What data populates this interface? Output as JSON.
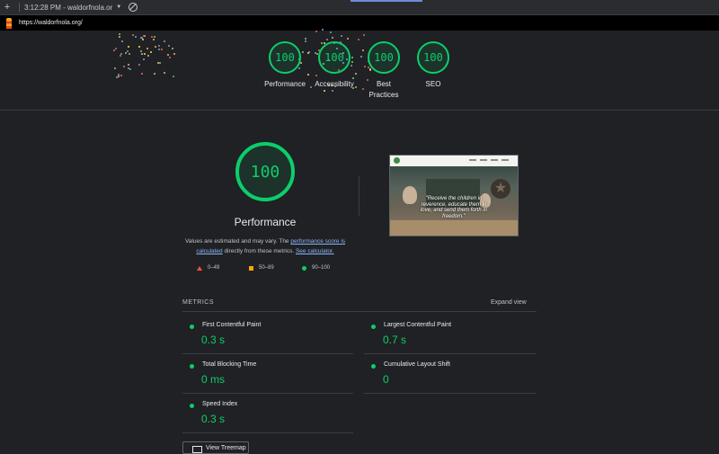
{
  "browser": {
    "time_title": "3:12:28 PM - waldorfnola.or",
    "url": "https://waldorfnola.org/"
  },
  "top_scores": [
    {
      "score": "100",
      "label": "Performance"
    },
    {
      "score": "100",
      "label": "Accessibility"
    },
    {
      "score": "100",
      "label": "Best Practices"
    },
    {
      "score": "100",
      "label": "SEO"
    }
  ],
  "performance": {
    "score": "100",
    "title": "Performance",
    "note_prefix": "Values are estimated and may vary. The ",
    "note_link": "performance score is calculated",
    "note_mid": " directly from these metrics. ",
    "note_link2": "See calculator."
  },
  "legend": {
    "fail": "0–49",
    "average": "50–89",
    "pass": "90–100"
  },
  "screenshot": {
    "quote": "\"Receive the children in reverence, educate them in love, and send them forth in freedom.\""
  },
  "metrics": {
    "title": "METRICS",
    "expand_label": "Expand view",
    "fcp": {
      "name": "First Contentful Paint",
      "value": "0.3 s"
    },
    "lcp": {
      "name": "Largest Contentful Paint",
      "value": "0.7 s"
    },
    "tbt": {
      "name": "Total Blocking Time",
      "value": "0 ms"
    },
    "cls": {
      "name": "Cumulative Layout Shift",
      "value": "0"
    },
    "si": {
      "name": "Speed Index",
      "value": "0.3 s"
    }
  },
  "view_treemap": "View Treemap",
  "colors": {
    "pass": "#0cce6b",
    "average": "#ffa400",
    "fail": "#ff4e42",
    "background": "#202124",
    "link": "#8ab4f8"
  }
}
